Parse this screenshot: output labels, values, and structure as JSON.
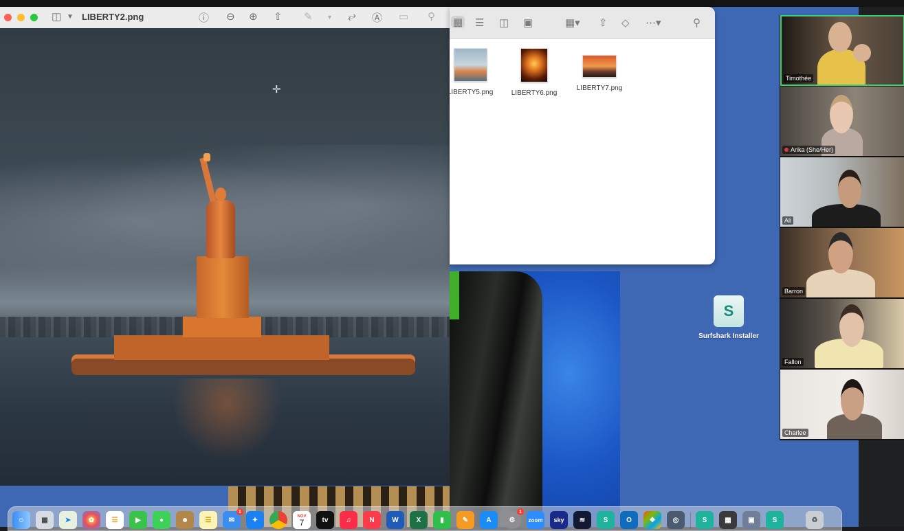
{
  "preview": {
    "title": "LIBERTY2.png",
    "toolbar_icons": [
      "sidebar-icon",
      "chevron-down-icon",
      "info-icon",
      "zoom-out-icon",
      "zoom-in-icon",
      "share-icon",
      "markup-pen-icon",
      "rotate-icon",
      "annotate-icon",
      "signature-icon",
      "search-icon"
    ]
  },
  "finder": {
    "files": [
      {
        "name": "LIBERTY5.png"
      },
      {
        "name": "LIBERTY6.png"
      },
      {
        "name": "LIBERTY7.png"
      }
    ]
  },
  "desktop": {
    "icon_label": "Surfshark Installer"
  },
  "zoom_gallery": {
    "participants": [
      {
        "name": "Timothée",
        "active_speaker": true,
        "muted": false
      },
      {
        "name": "Arika (She/Her)",
        "active_speaker": false,
        "muted": true
      },
      {
        "name": "Ali",
        "active_speaker": false,
        "muted": false
      },
      {
        "name": "Barron",
        "active_speaker": false,
        "muted": false
      },
      {
        "name": "Fallon",
        "active_speaker": false,
        "muted": false
      },
      {
        "name": "Charlee",
        "active_speaker": false,
        "muted": false
      }
    ]
  },
  "dock": {
    "calendar_month": "NOV",
    "calendar_day": "7",
    "mail_badge": "1",
    "settings_badge": "1",
    "zoom_label": "zoom",
    "sky_label": "sky"
  },
  "colors": {
    "desktop": "#3f68b4",
    "active_speaker_border": "#3bd16f",
    "surfshark": "#178b7b"
  }
}
